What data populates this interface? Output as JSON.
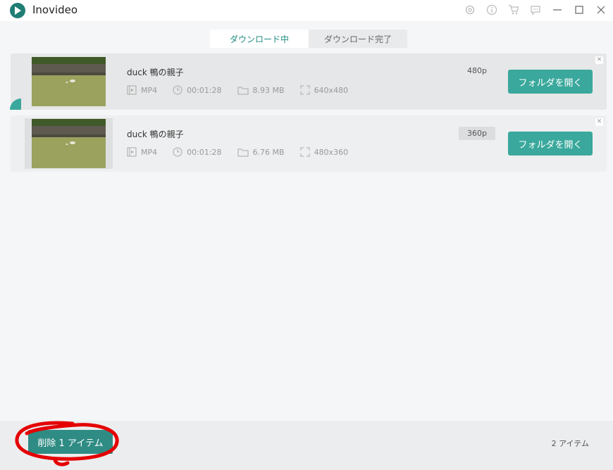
{
  "app": {
    "title": "Inovideo"
  },
  "titlebar_icons": [
    "settings-icon",
    "info-icon",
    "cart-icon",
    "chat-icon",
    "minimize-icon",
    "maximize-icon",
    "close-icon"
  ],
  "tabs": [
    {
      "label": "ダウンロード中",
      "active": true
    },
    {
      "label": "ダウンロード完了",
      "active": false
    }
  ],
  "items": [
    {
      "title": "duck 鴨の親子",
      "format": "MP4",
      "duration": "00:01:28",
      "size": "8.93 MB",
      "dimensions": "640x480",
      "resolution": "480p",
      "open_label": "フォルダを開く"
    },
    {
      "title": "duck 鴨の親子",
      "format": "MP4",
      "duration": "00:01:28",
      "size": "6.76 MB",
      "dimensions": "480x360",
      "resolution": "360p",
      "open_label": "フォルダを開く"
    }
  ],
  "footer": {
    "delete_label": "削除 1 アイテム",
    "count_label": "2 アイテム"
  },
  "colors": {
    "accent": "#3aa89c",
    "annotation": "#e50000"
  }
}
